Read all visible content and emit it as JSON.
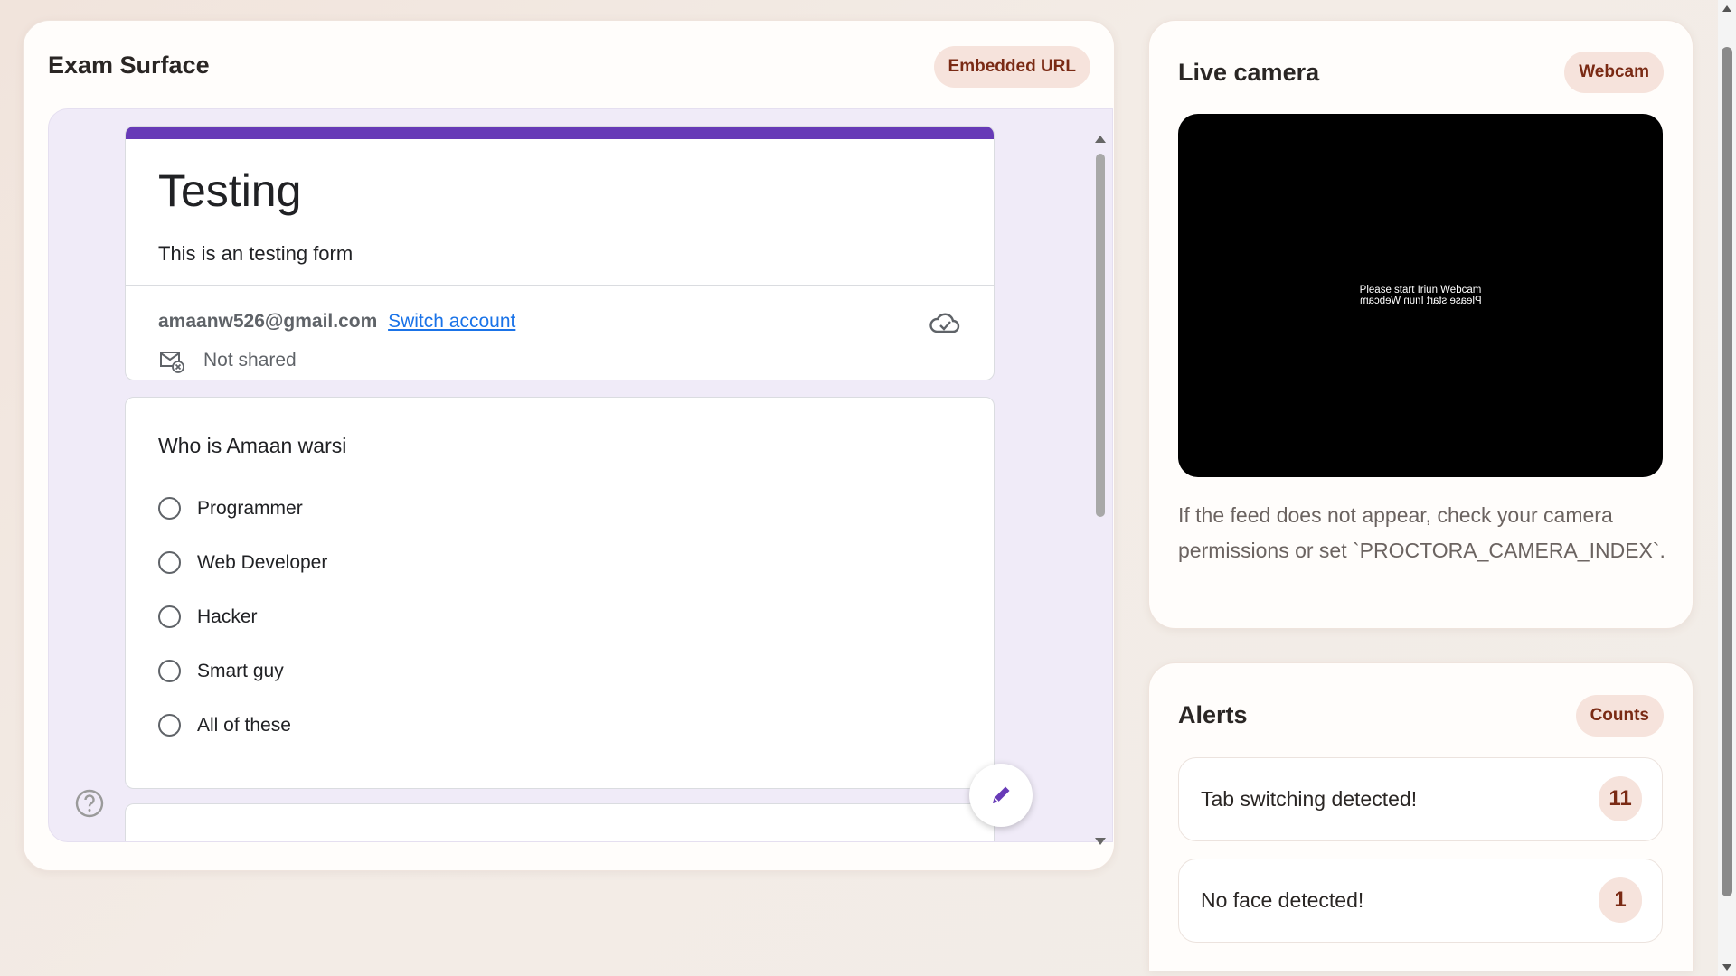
{
  "exam": {
    "title": "Exam Surface",
    "badge": "Embedded URL",
    "form": {
      "title": "Testing",
      "description": "This is an testing form",
      "account_email": "amaanw526@gmail.com",
      "switch_account": "Switch account",
      "not_shared": "Not shared",
      "question": "Who is Amaan warsi",
      "options": [
        "Programmer",
        "Web Developer",
        "Hacker",
        "Smart guy",
        "All of these"
      ],
      "accent_color": "#673ab7"
    }
  },
  "camera": {
    "title": "Live camera",
    "badge": "Webcam",
    "feed_text": "Please start Iriun Webcam",
    "note": "If the feed does not appear, check your camera permissions or set `PROCTORA_CAMERA_INDEX`."
  },
  "alerts": {
    "title": "Alerts",
    "badge": "Counts",
    "items": [
      {
        "label": "Tab switching detected!",
        "count": "11"
      },
      {
        "label": "No face detected!",
        "count": "1"
      }
    ]
  }
}
